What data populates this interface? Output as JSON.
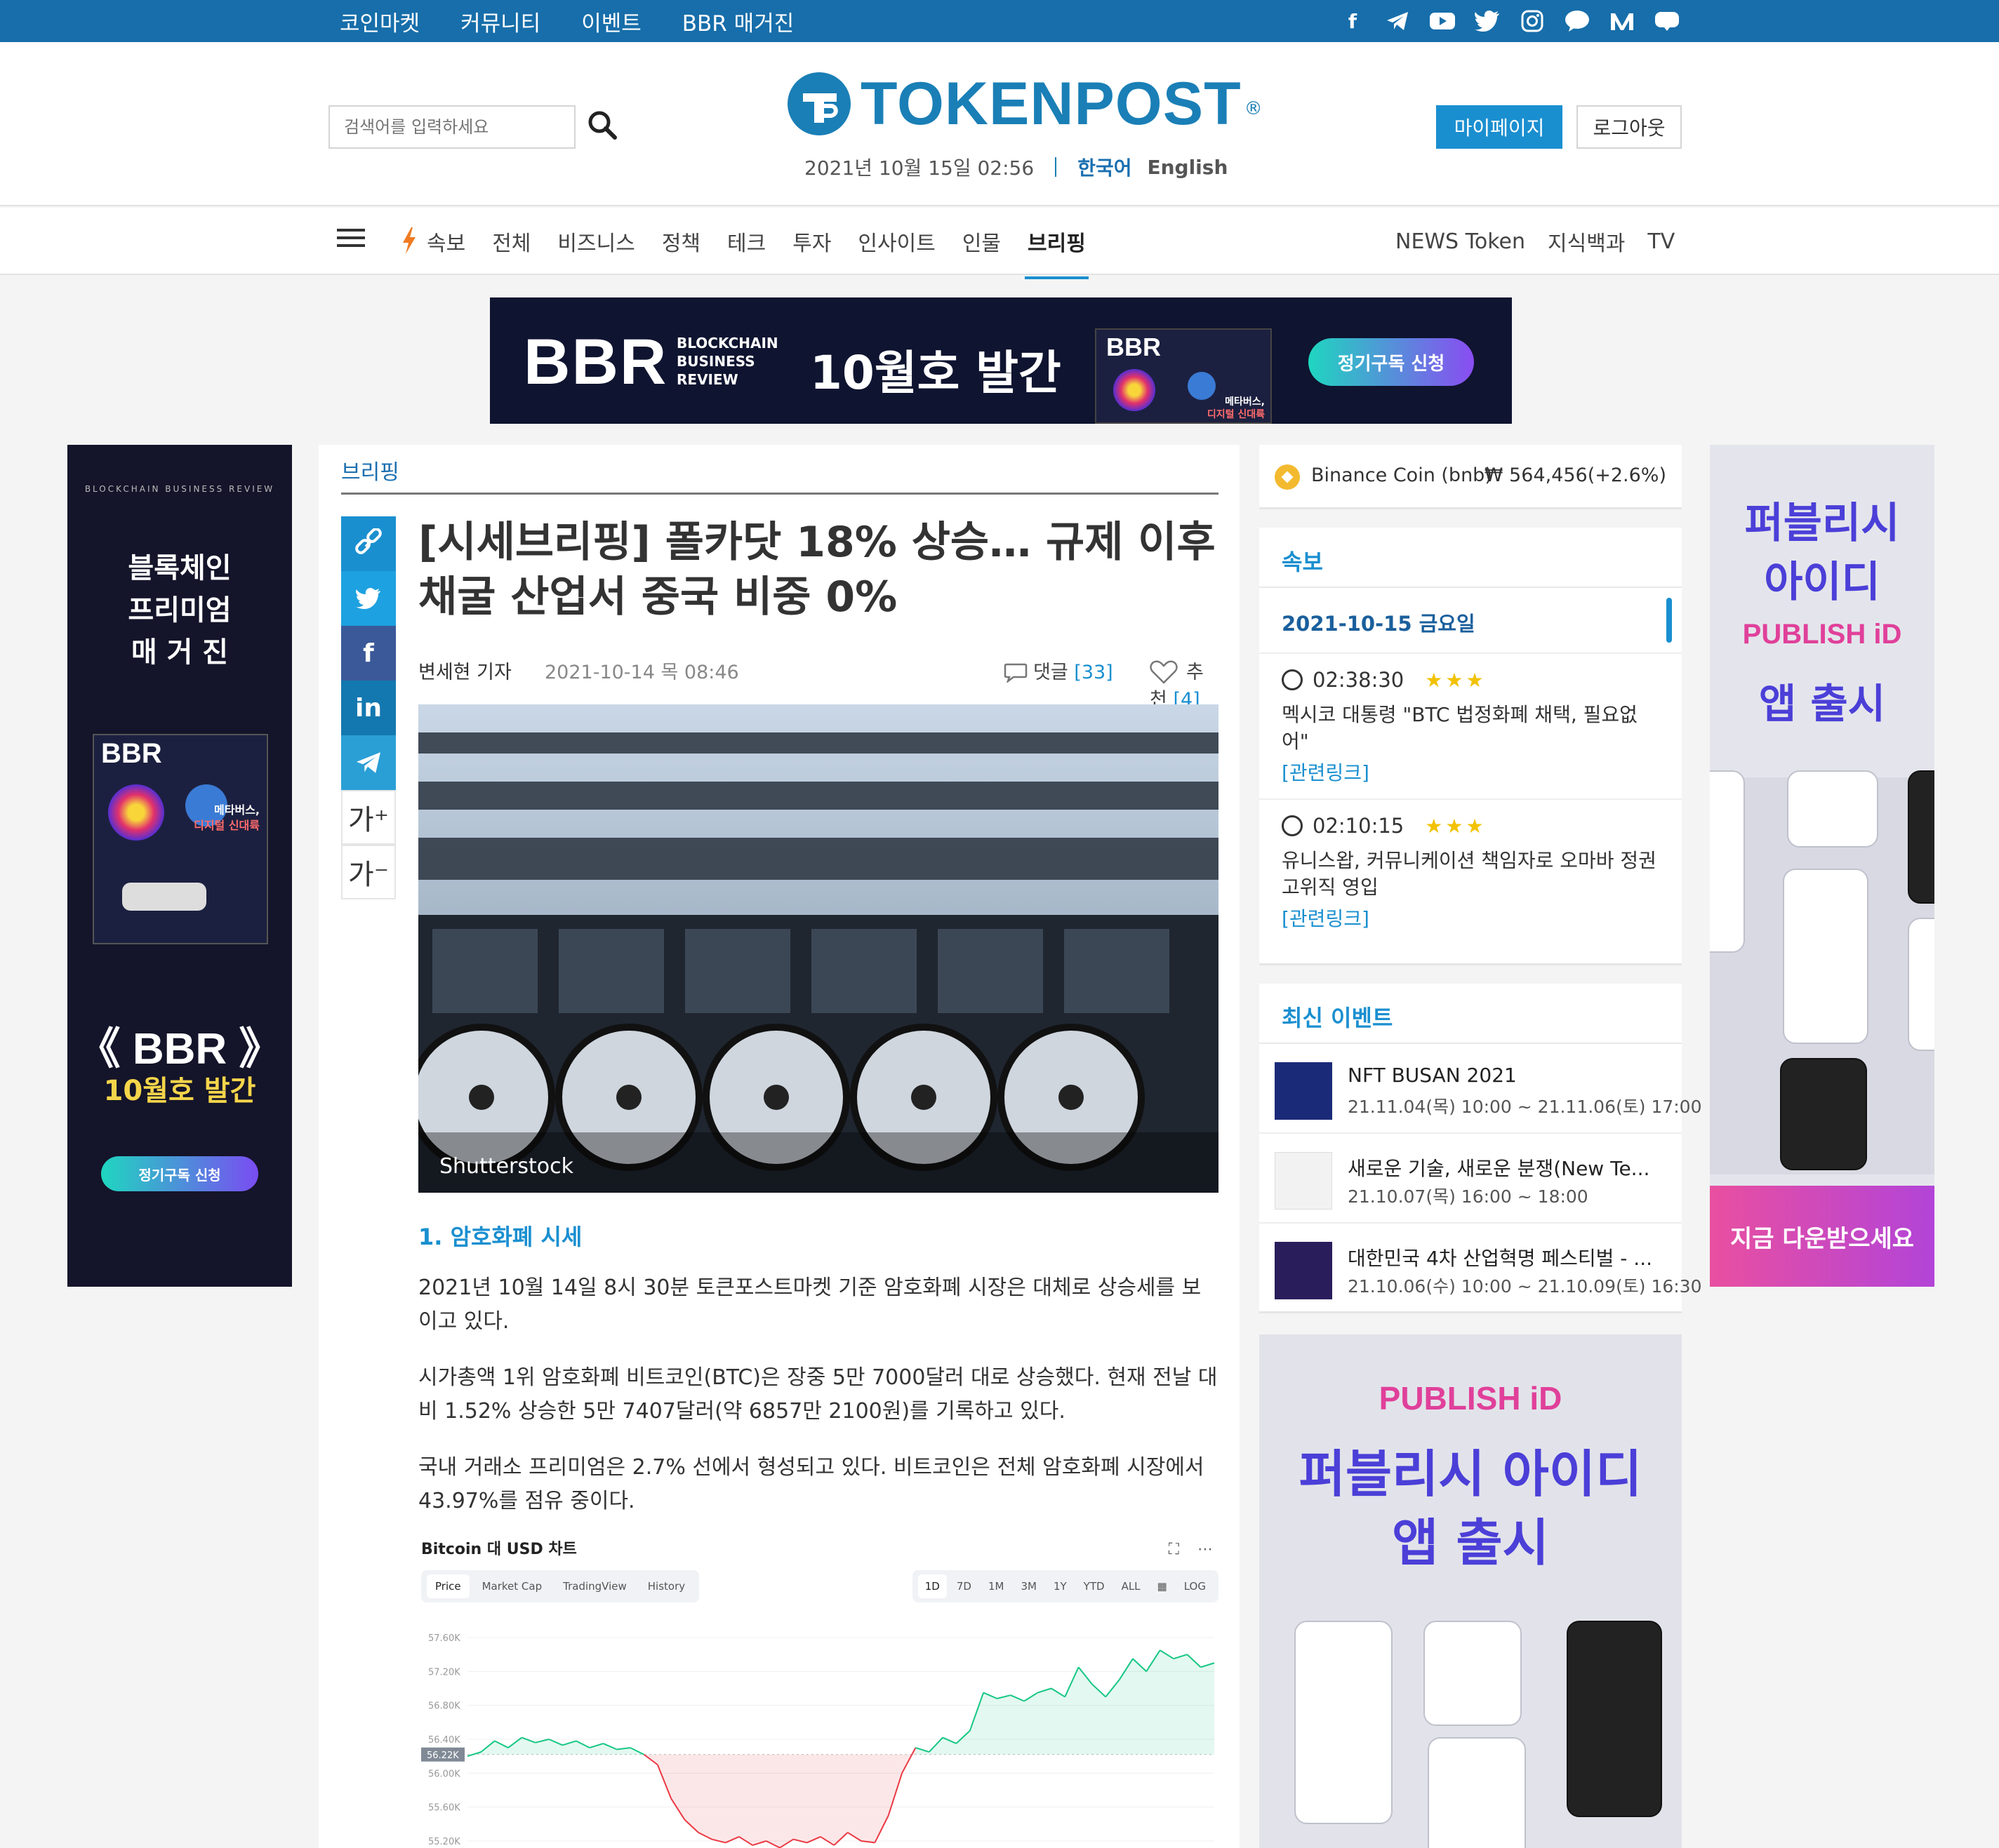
{
  "topbar": {
    "menu": [
      "코인마켓",
      "커뮤니티",
      "이벤트",
      "BBR 매거진"
    ],
    "social_icons": [
      "facebook-icon",
      "telegram-icon",
      "youtube-icon",
      "twitter-icon",
      "instagram-icon",
      "kakaotalk-icon",
      "medium-icon",
      "blog-icon"
    ]
  },
  "header": {
    "search_placeholder": "검색어를 입력하세요",
    "logo_text": "TOKENPOST",
    "logo_reg": "®",
    "datetime": "2021년 10월 15일 02:56",
    "lang_ko": "한국어",
    "lang_en": "English",
    "mypage": "마이페이지",
    "logout": "로그아웃"
  },
  "nav": {
    "items": [
      "속보",
      "전체",
      "비즈니스",
      "정책",
      "테크",
      "투자",
      "인사이트",
      "인물",
      "브리핑"
    ],
    "active": "브리핑",
    "right": [
      "NEWS Token",
      "지식백과",
      "TV"
    ]
  },
  "banner": {
    "bbr": "BBR",
    "sub": [
      "BLOCKCHAIN",
      "BUSINESS",
      "REVIEW"
    ],
    "issue": "10월호 발간",
    "cta": "정기구독 신청",
    "cover_text": [
      "메타버스,",
      "디지털 신대륙"
    ]
  },
  "left_ad": {
    "tag": "BLOCKCHAIN BUSINESS REVIEW",
    "title": [
      "블록체인",
      "프리미엄",
      "매 거 진"
    ],
    "cover_text": [
      "메타버스,",
      "디지털 신대륙"
    ],
    "bbr": "《 BBR 》",
    "issue": "10월호 발간",
    "cta": "정기구독 신청"
  },
  "article": {
    "breadcrumb": "브리핑",
    "headline": "[시세브리핑] 폴카닷 18% 상승… 규제 이후 채굴 산업서 중국 비중 0%",
    "author": "변세현 기자",
    "date": "2021-10-14 목 08:46",
    "comments_label": "댓글",
    "comments_count": "[33]",
    "likes_label": "추천",
    "likes_count": "[4]",
    "photo_credit": "Shutterstock",
    "section1": "1. 암호화폐 시세",
    "para1": "2021년 10월 14일 8시 30분 토큰포스트마켓 기준 암호화폐 시장은 대체로 상승세를 보이고 있다.",
    "para2": "시가총액 1위 암호화폐 비트코인(BTC)은 장중 5만 7000달러 대로 상승했다. 현재 전날 대비 1.52% 상승한 5만 7407달러(약 6857만 2100원)를 기록하고 있다.",
    "para3": "국내 거래소 프리미엄은 2.7% 선에서 형성되고 있다. 비트코인은 전체 암호화폐 시장에서 43.97%를 점유 중이다.",
    "font_up": "가⁺",
    "font_down": "가⁻"
  },
  "embed_chart": {
    "title": "Bitcoin 대 USD 차트",
    "tabs": [
      "Price",
      "Market Cap",
      "TradingView",
      "History"
    ],
    "ranges": [
      "1D",
      "7D",
      "1M",
      "3M",
      "1Y",
      "YTD",
      "ALL",
      "LOG"
    ],
    "current_label": "56.22K"
  },
  "chart_data": {
    "type": "line",
    "title": "Bitcoin 대 USD 차트",
    "y_ticks": [
      "57.60K",
      "57.20K",
      "56.80K",
      "56.40K",
      "56.00K",
      "55.60K",
      "55.20K"
    ],
    "ylim": [
      55.2,
      57.6
    ],
    "baseline": 56.22,
    "values": [
      56.2,
      56.25,
      56.38,
      56.3,
      56.42,
      56.36,
      56.4,
      56.33,
      56.38,
      56.3,
      56.35,
      56.28,
      56.3,
      56.22,
      56.1,
      55.7,
      55.45,
      55.3,
      55.22,
      55.18,
      55.25,
      55.15,
      55.2,
      55.12,
      55.22,
      55.18,
      55.25,
      55.15,
      55.3,
      55.2,
      55.18,
      55.5,
      56.0,
      56.3,
      56.25,
      56.42,
      56.35,
      56.5,
      56.95,
      56.88,
      56.92,
      56.85,
      56.95,
      57.0,
      56.9,
      57.25,
      57.05,
      56.9,
      57.1,
      57.35,
      57.2,
      57.45,
      57.35,
      57.4,
      57.25,
      57.3
    ]
  },
  "ticker": {
    "coin": "Binance Coin (bnb)",
    "price": "₩ 564,456(+2.6%)"
  },
  "flash": {
    "title": "속보",
    "day": "2021-10-15 금요일",
    "items": [
      {
        "time": "02:38:30",
        "stars": "★★★",
        "text": "멕시코 대통령 \"BTC 법정화폐 채택, 필요없어\"",
        "link": "[관련링크]"
      },
      {
        "time": "02:10:15",
        "stars": "★★★",
        "text": "유니스왑, 커뮤니케이션 책임자로 오마바 정권 고위직 영입",
        "link": "[관련링크]"
      }
    ]
  },
  "events": {
    "title": "최신 이벤트",
    "items": [
      {
        "name": "NFT BUSAN 2021",
        "date": "21.11.04(목) 10:00 ~ 21.11.06(토) 17:00"
      },
      {
        "name": "새로운 기술, 새로운 분쟁(New Te...",
        "date": "21.10.07(목) 16:00 ~ 18:00"
      },
      {
        "name": "대한민국 4차 산업혁명 페스티벌 - ...",
        "date": "21.10.06(수) 10:00 ~ 21.10.09(토) 16:30"
      }
    ]
  },
  "publish_ad": {
    "brand": "PUBLISH iD",
    "headline": [
      "퍼블리시 아이디",
      "앱 출시"
    ]
  },
  "right_ad": {
    "title": [
      "퍼블리시",
      "아이디"
    ],
    "brand": "PUBLISH iD",
    "sub": "앱 출시",
    "cta": "지금 다운받으세요"
  }
}
